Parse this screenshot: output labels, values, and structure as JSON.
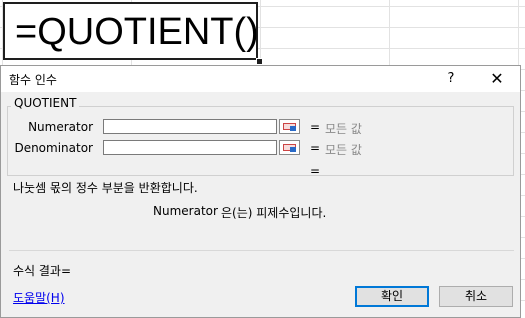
{
  "sheet": {
    "cell_formula": "=QUOTIENT()"
  },
  "dialog": {
    "title": "함수 인수",
    "help_button": "?",
    "close_button": "✕",
    "function_name": "QUOTIENT",
    "arguments": [
      {
        "label": "Numerator",
        "value": "",
        "equals": "=",
        "result": "모든 값"
      },
      {
        "label": "Denominator",
        "value": "",
        "equals": "=",
        "result": "모든 값"
      }
    ],
    "result_equals": "=",
    "description": "나눗셈 몫의 정수 부분을 반환합니다.",
    "arg_description_name": "Numerator",
    "arg_description_text": "은(는) 피제수입니다.",
    "formula_result_label": "수식 결과=",
    "help_link": "도움말(H)",
    "ok_button": "확인",
    "cancel_button": "취소",
    "icons": [
      "collapse-dialog-icon"
    ],
    "colors": {
      "ok_focus": "#0078d7",
      "link": "#0000ee"
    }
  }
}
